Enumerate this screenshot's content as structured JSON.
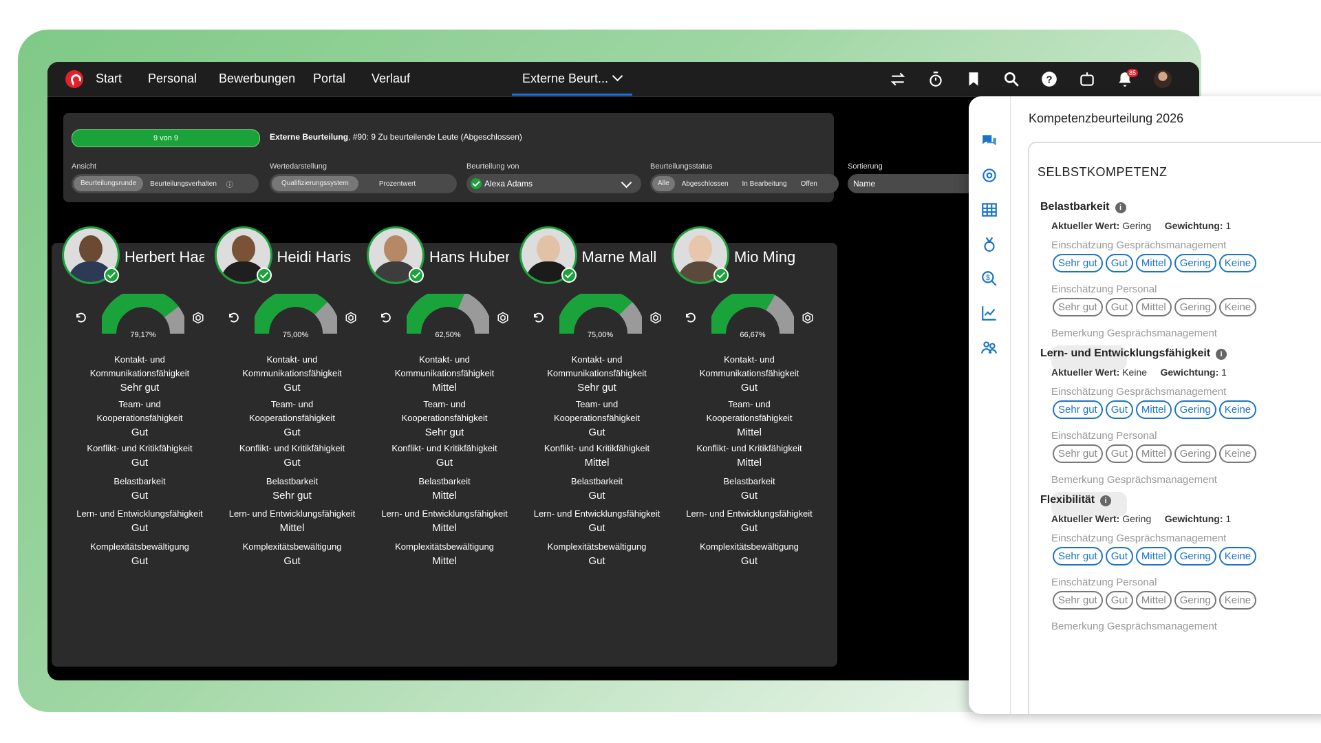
{
  "nav": {
    "items": [
      "Start",
      "Personal",
      "Bewerbungen",
      "Portal",
      "Verlauf"
    ],
    "active_item": "Externe Beurt...",
    "notification_count": "85"
  },
  "filters": {
    "progress_label": "9 von 9",
    "progress_fraction": 1.0,
    "title_bold": "Externe Beurteilung",
    "title_rest": ", #90: 9 Zu beurteilende Leute (Abgeschlossen)",
    "ansicht_label": "Ansicht",
    "ansicht_options": [
      "Beurteilungsrunde",
      "Beurteilungsverhalten"
    ],
    "werte_label": "Wertedarstellung",
    "werte_options": [
      "Qualifizierungssystem",
      "Prozentwert"
    ],
    "beurteilung_label": "Beurteilung von",
    "beurteilung_value": "Alexa Adams",
    "status_label": "Beurteilungsstatus",
    "status_options": [
      "Alle",
      "Abgeschlossen",
      "In Bearbeitung",
      "Offen"
    ],
    "sort_label": "Sortierung",
    "sort_value": "Name"
  },
  "criteria_labels": [
    [
      "Kontakt- und",
      "Kommunikationsfähigkeit"
    ],
    [
      "Team- und",
      "Kooperationsfähigkeit"
    ],
    [
      "Konflikt- und Kritikfähigkeit"
    ],
    [
      "Belastbarkeit"
    ],
    [
      "Lern- und Entwicklungsfähigkeit"
    ],
    [
      "Komplexitätsbewältigung"
    ]
  ],
  "people": [
    {
      "name": "Herbert Haas",
      "percent": "79,17%",
      "fraction": 0.7917,
      "values": [
        "Sehr gut",
        "Gut",
        "Gut",
        "Gut",
        "Gut",
        "Gut"
      ]
    },
    {
      "name": "Heidi Haris",
      "percent": "75,00%",
      "fraction": 0.75,
      "values": [
        "Gut",
        "Gut",
        "Gut",
        "Sehr gut",
        "Mittel",
        "Gut"
      ]
    },
    {
      "name": "Hans Huber",
      "percent": "62,50%",
      "fraction": 0.625,
      "values": [
        "Mittel",
        "Sehr gut",
        "Gut",
        "Mittel",
        "Mittel",
        "Mittel"
      ]
    },
    {
      "name": "Marne Mall",
      "percent": "75,00%",
      "fraction": 0.75,
      "values": [
        "Sehr gut",
        "Gut",
        "Mittel",
        "Gut",
        "Gut",
        "Gut"
      ]
    },
    {
      "name": "Mio Ming",
      "percent": "66,67%",
      "fraction": 0.6667,
      "values": [
        "Gut",
        "Mittel",
        "Mittel",
        "Gut",
        "Gut",
        "Gut"
      ]
    }
  ],
  "panel": {
    "title": "Kompetenzbeurteilung 2026",
    "section": "SELBSTKOMPETENZ",
    "aktueller_label": "Aktueller Wert:",
    "gewichtung_label": "Gewichtung:",
    "gm_label": "Einschätzung Gesprächsmanagement",
    "personal_label": "Einschätzung Personal",
    "remark_label": "Bemerkung Gesprächsmanagement",
    "options": [
      "Sehr gut",
      "Gut",
      "Mittel",
      "Gering",
      "Keine"
    ],
    "competencies": [
      {
        "title": "Belastbarkeit",
        "aktuell": "Gering",
        "gewichtung": "1"
      },
      {
        "title": "Lern- und Entwicklungsfähigkeit",
        "aktuell": "Keine",
        "gewichtung": "1"
      },
      {
        "title": "Flexibilität",
        "aktuell": "Gering",
        "gewichtung": "1"
      }
    ]
  },
  "colors": {
    "accent_green": "#1aa33a",
    "gauge_rest": "#9a9a9a",
    "link_blue": "#1a73c8",
    "brand_red": "#e4202a"
  }
}
